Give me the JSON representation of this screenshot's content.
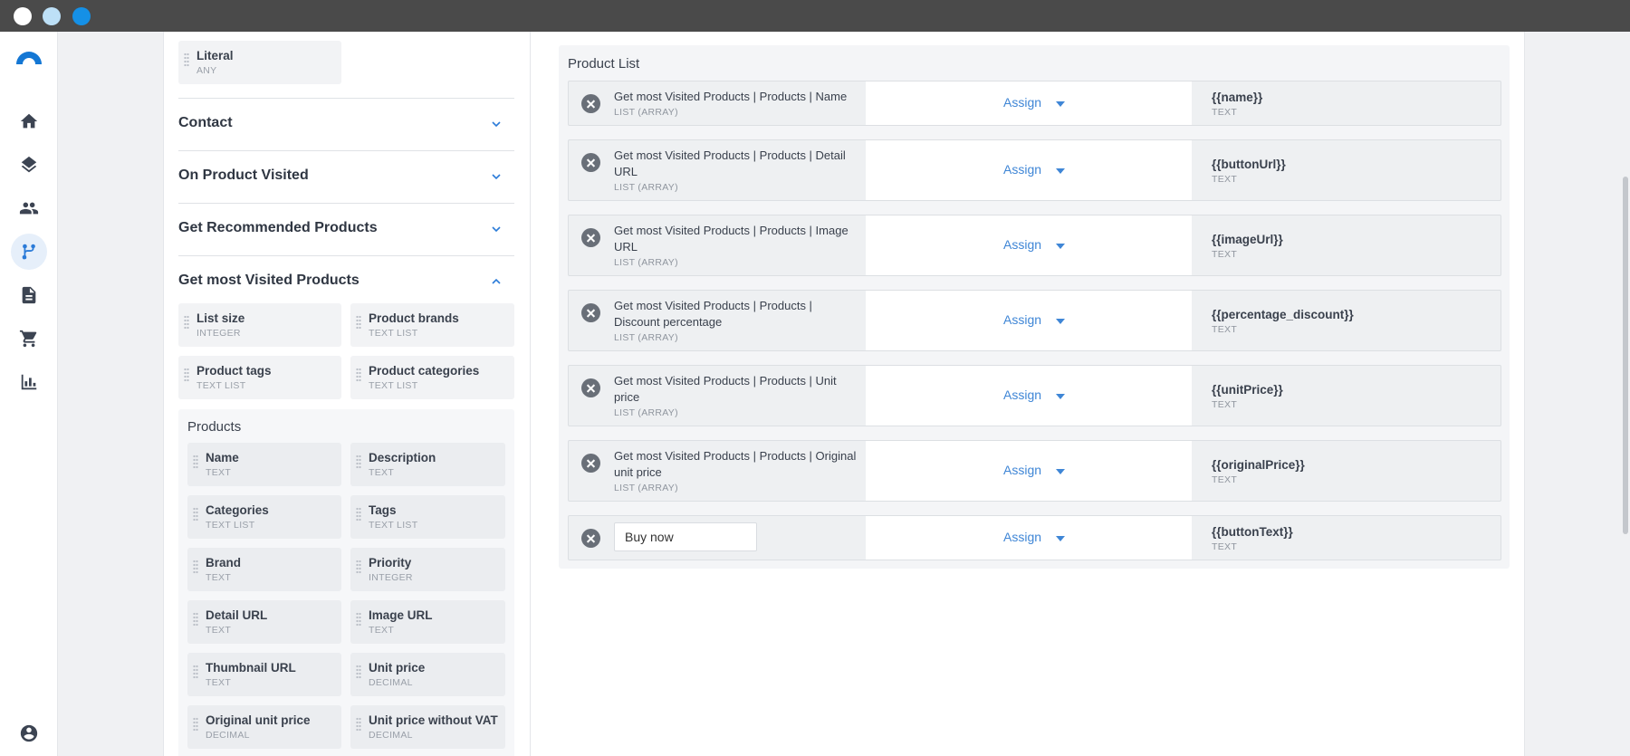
{
  "colors": {
    "accent": "#2b7bd8",
    "link": "#3f86d6",
    "titlebar": "#4a4a4a"
  },
  "sidebar": {
    "items": [
      {
        "icon": "home-icon"
      },
      {
        "icon": "layers-icon"
      },
      {
        "icon": "people-icon"
      },
      {
        "icon": "flow-icon",
        "active": true
      },
      {
        "icon": "document-icon"
      },
      {
        "icon": "cart-icon"
      },
      {
        "icon": "bar-chart-icon"
      },
      {
        "icon": "account-icon"
      }
    ]
  },
  "left": {
    "literal": {
      "name": "Literal",
      "type": "ANY"
    },
    "sections": [
      {
        "title": "Contact"
      },
      {
        "title": "On Product Visited"
      },
      {
        "title": "Get Recommended Products"
      },
      {
        "title": "Get most Visited Products"
      }
    ],
    "params": [
      {
        "name": "List size",
        "type": "INTEGER"
      },
      {
        "name": "Product brands",
        "type": "TEXT LIST"
      },
      {
        "name": "Product tags",
        "type": "TEXT LIST"
      },
      {
        "name": "Product categories",
        "type": "TEXT LIST"
      }
    ],
    "products": {
      "title": "Products",
      "fields": [
        {
          "name": "Name",
          "type": "TEXT"
        },
        {
          "name": "Description",
          "type": "TEXT"
        },
        {
          "name": "Categories",
          "type": "TEXT LIST"
        },
        {
          "name": "Tags",
          "type": "TEXT LIST"
        },
        {
          "name": "Brand",
          "type": "TEXT"
        },
        {
          "name": "Priority",
          "type": "INTEGER"
        },
        {
          "name": "Detail URL",
          "type": "TEXT"
        },
        {
          "name": "Image URL",
          "type": "TEXT"
        },
        {
          "name": "Thumbnail URL",
          "type": "TEXT"
        },
        {
          "name": "Unit price",
          "type": "DECIMAL"
        },
        {
          "name": "Original unit price",
          "type": "DECIMAL"
        },
        {
          "name": "Unit price without VAT",
          "type": "DECIMAL"
        }
      ]
    }
  },
  "right": {
    "title": "Product List",
    "rows": [
      {
        "source": "Get most Visited Products | Products | Name",
        "source_type": "LIST (ARRAY)",
        "action": "Assign",
        "target": "{{name}}",
        "target_type": "TEXT"
      },
      {
        "source": "Get most Visited Products | Products | Detail URL",
        "source_type": "LIST (ARRAY)",
        "action": "Assign",
        "target": "{{buttonUrl}}",
        "target_type": "TEXT"
      },
      {
        "source": "Get most Visited Products | Products | Image URL",
        "source_type": "LIST (ARRAY)",
        "action": "Assign",
        "target": "{{imageUrl}}",
        "target_type": "TEXT"
      },
      {
        "source": "Get most Visited Products | Products | Discount percentage",
        "source_type": "LIST (ARRAY)",
        "action": "Assign",
        "target": "{{percentage_discount}}",
        "target_type": "TEXT"
      },
      {
        "source": "Get most Visited Products | Products | Unit price",
        "source_type": "LIST (ARRAY)",
        "action": "Assign",
        "target": "{{unitPrice}}",
        "target_type": "TEXT"
      },
      {
        "source": "Get most Visited Products | Products | Original unit price",
        "source_type": "LIST (ARRAY)",
        "action": "Assign",
        "target": "{{originalPrice}}",
        "target_type": "TEXT"
      }
    ],
    "constant_row": {
      "value": "Buy now",
      "action": "Assign",
      "target": "{{buttonText}}",
      "target_type": "TEXT"
    }
  }
}
